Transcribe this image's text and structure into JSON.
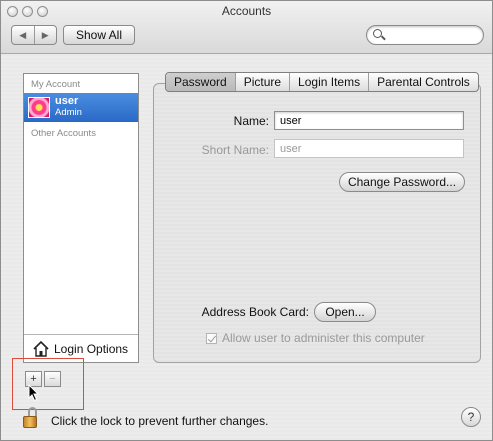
{
  "window": {
    "title": "Accounts"
  },
  "toolbar": {
    "back_symbol": "◀",
    "forward_symbol": "▶",
    "show_all_label": "Show All",
    "search": {
      "value": "",
      "placeholder": ""
    }
  },
  "sidebar": {
    "my_account_header": "My Account",
    "current_user": {
      "name": "user",
      "role": "Admin",
      "icon": "flower-picture-icon"
    },
    "other_accounts_header": "Other Accounts",
    "login_options_label": "Login Options"
  },
  "account_buttons": {
    "add_label": "+",
    "remove_label": "−"
  },
  "tabs": [
    {
      "label": "Password",
      "selected": true
    },
    {
      "label": "Picture",
      "selected": false
    },
    {
      "label": "Login Items",
      "selected": false
    },
    {
      "label": "Parental Controls",
      "selected": false
    }
  ],
  "form": {
    "name_label": "Name:",
    "name_value": "user",
    "short_name_label": "Short Name:",
    "short_name_value": "user",
    "change_password_label": "Change Password...",
    "address_book_label": "Address Book Card:",
    "open_label": "Open...",
    "admin_checkbox_label": "Allow user to administer this computer",
    "admin_checked": true
  },
  "footer": {
    "lock_text": "Click the lock to prevent further changes.",
    "help_label": "?"
  },
  "colors": {
    "selection": "#2f6fcb",
    "highlight_box": "#e04a3a"
  }
}
